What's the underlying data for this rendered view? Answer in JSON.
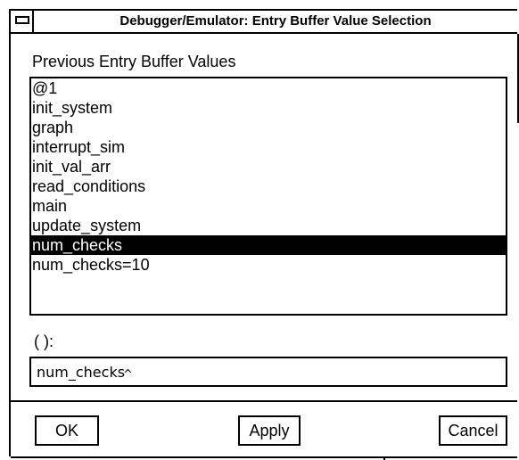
{
  "window": {
    "title": "Debugger/Emulator: Entry Buffer Value Selection"
  },
  "history": {
    "label": "Previous Entry Buffer Values",
    "items": [
      "@1",
      "init_system",
      "graph",
      "interrupt_sim",
      "init_val_arr",
      "read_conditions",
      "main",
      "update_system",
      "num_checks",
      "num_checks=10"
    ],
    "selected_index": 8
  },
  "entry": {
    "label": "( ):",
    "value": "num_checks",
    "caret": "^"
  },
  "buttons": {
    "ok": "OK",
    "apply": "Apply",
    "cancel": "Cancel"
  },
  "icons": {
    "window_menu": "window-menu-icon"
  }
}
